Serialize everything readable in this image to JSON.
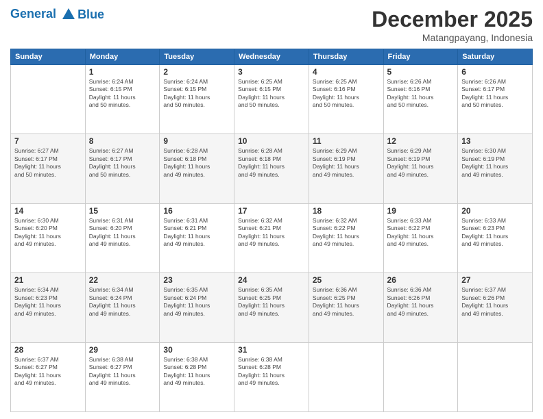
{
  "header": {
    "logo_line1": "General",
    "logo_line2": "Blue",
    "month": "December 2025",
    "location": "Matangpayang, Indonesia"
  },
  "weekdays": [
    "Sunday",
    "Monday",
    "Tuesday",
    "Wednesday",
    "Thursday",
    "Friday",
    "Saturday"
  ],
  "weeks": [
    [
      {
        "day": "",
        "info": ""
      },
      {
        "day": "1",
        "info": "Sunrise: 6:24 AM\nSunset: 6:15 PM\nDaylight: 11 hours\nand 50 minutes."
      },
      {
        "day": "2",
        "info": "Sunrise: 6:24 AM\nSunset: 6:15 PM\nDaylight: 11 hours\nand 50 minutes."
      },
      {
        "day": "3",
        "info": "Sunrise: 6:25 AM\nSunset: 6:15 PM\nDaylight: 11 hours\nand 50 minutes."
      },
      {
        "day": "4",
        "info": "Sunrise: 6:25 AM\nSunset: 6:16 PM\nDaylight: 11 hours\nand 50 minutes."
      },
      {
        "day": "5",
        "info": "Sunrise: 6:26 AM\nSunset: 6:16 PM\nDaylight: 11 hours\nand 50 minutes."
      },
      {
        "day": "6",
        "info": "Sunrise: 6:26 AM\nSunset: 6:17 PM\nDaylight: 11 hours\nand 50 minutes."
      }
    ],
    [
      {
        "day": "7",
        "info": "Sunrise: 6:27 AM\nSunset: 6:17 PM\nDaylight: 11 hours\nand 50 minutes."
      },
      {
        "day": "8",
        "info": "Sunrise: 6:27 AM\nSunset: 6:17 PM\nDaylight: 11 hours\nand 50 minutes."
      },
      {
        "day": "9",
        "info": "Sunrise: 6:28 AM\nSunset: 6:18 PM\nDaylight: 11 hours\nand 49 minutes."
      },
      {
        "day": "10",
        "info": "Sunrise: 6:28 AM\nSunset: 6:18 PM\nDaylight: 11 hours\nand 49 minutes."
      },
      {
        "day": "11",
        "info": "Sunrise: 6:29 AM\nSunset: 6:19 PM\nDaylight: 11 hours\nand 49 minutes."
      },
      {
        "day": "12",
        "info": "Sunrise: 6:29 AM\nSunset: 6:19 PM\nDaylight: 11 hours\nand 49 minutes."
      },
      {
        "day": "13",
        "info": "Sunrise: 6:30 AM\nSunset: 6:19 PM\nDaylight: 11 hours\nand 49 minutes."
      }
    ],
    [
      {
        "day": "14",
        "info": "Sunrise: 6:30 AM\nSunset: 6:20 PM\nDaylight: 11 hours\nand 49 minutes."
      },
      {
        "day": "15",
        "info": "Sunrise: 6:31 AM\nSunset: 6:20 PM\nDaylight: 11 hours\nand 49 minutes."
      },
      {
        "day": "16",
        "info": "Sunrise: 6:31 AM\nSunset: 6:21 PM\nDaylight: 11 hours\nand 49 minutes."
      },
      {
        "day": "17",
        "info": "Sunrise: 6:32 AM\nSunset: 6:21 PM\nDaylight: 11 hours\nand 49 minutes."
      },
      {
        "day": "18",
        "info": "Sunrise: 6:32 AM\nSunset: 6:22 PM\nDaylight: 11 hours\nand 49 minutes."
      },
      {
        "day": "19",
        "info": "Sunrise: 6:33 AM\nSunset: 6:22 PM\nDaylight: 11 hours\nand 49 minutes."
      },
      {
        "day": "20",
        "info": "Sunrise: 6:33 AM\nSunset: 6:23 PM\nDaylight: 11 hours\nand 49 minutes."
      }
    ],
    [
      {
        "day": "21",
        "info": "Sunrise: 6:34 AM\nSunset: 6:23 PM\nDaylight: 11 hours\nand 49 minutes."
      },
      {
        "day": "22",
        "info": "Sunrise: 6:34 AM\nSunset: 6:24 PM\nDaylight: 11 hours\nand 49 minutes."
      },
      {
        "day": "23",
        "info": "Sunrise: 6:35 AM\nSunset: 6:24 PM\nDaylight: 11 hours\nand 49 minutes."
      },
      {
        "day": "24",
        "info": "Sunrise: 6:35 AM\nSunset: 6:25 PM\nDaylight: 11 hours\nand 49 minutes."
      },
      {
        "day": "25",
        "info": "Sunrise: 6:36 AM\nSunset: 6:25 PM\nDaylight: 11 hours\nand 49 minutes."
      },
      {
        "day": "26",
        "info": "Sunrise: 6:36 AM\nSunset: 6:26 PM\nDaylight: 11 hours\nand 49 minutes."
      },
      {
        "day": "27",
        "info": "Sunrise: 6:37 AM\nSunset: 6:26 PM\nDaylight: 11 hours\nand 49 minutes."
      }
    ],
    [
      {
        "day": "28",
        "info": "Sunrise: 6:37 AM\nSunset: 6:27 PM\nDaylight: 11 hours\nand 49 minutes."
      },
      {
        "day": "29",
        "info": "Sunrise: 6:38 AM\nSunset: 6:27 PM\nDaylight: 11 hours\nand 49 minutes."
      },
      {
        "day": "30",
        "info": "Sunrise: 6:38 AM\nSunset: 6:28 PM\nDaylight: 11 hours\nand 49 minutes."
      },
      {
        "day": "31",
        "info": "Sunrise: 6:38 AM\nSunset: 6:28 PM\nDaylight: 11 hours\nand 49 minutes."
      },
      {
        "day": "",
        "info": ""
      },
      {
        "day": "",
        "info": ""
      },
      {
        "day": "",
        "info": ""
      }
    ]
  ]
}
